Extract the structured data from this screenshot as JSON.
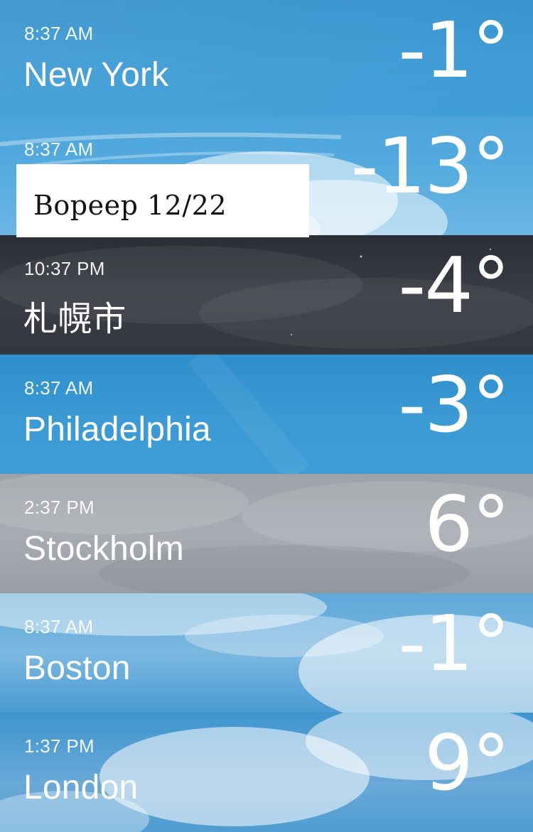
{
  "cities": [
    {
      "time": "8:37 AM",
      "name": "New York",
      "temp": "-1°",
      "theme": "clear-day"
    },
    {
      "time": "8:37 AM",
      "name": "",
      "temp": "-13°",
      "theme": "cloudy-day"
    },
    {
      "time": "10:37 PM",
      "name": "札幌市",
      "temp": "-4°",
      "theme": "cloudy-night"
    },
    {
      "time": "8:37 AM",
      "name": "Philadelphia",
      "temp": "-3°",
      "theme": "clear-day"
    },
    {
      "time": "2:37 PM",
      "name": "Stockholm",
      "temp": "6°",
      "theme": "overcast"
    },
    {
      "time": "8:37 AM",
      "name": "Boston",
      "temp": "-1°",
      "theme": "cloudy-day"
    },
    {
      "time": "1:37 PM",
      "name": "London",
      "temp": "9°",
      "theme": "cloudy-day"
    }
  ],
  "overlay_label": {
    "text": "Bopeep 12/22"
  },
  "colors": {
    "clear_day": "#3b9ad4",
    "night": "#34373f",
    "overcast": "#a4a8ae",
    "text": "#ffffff"
  }
}
